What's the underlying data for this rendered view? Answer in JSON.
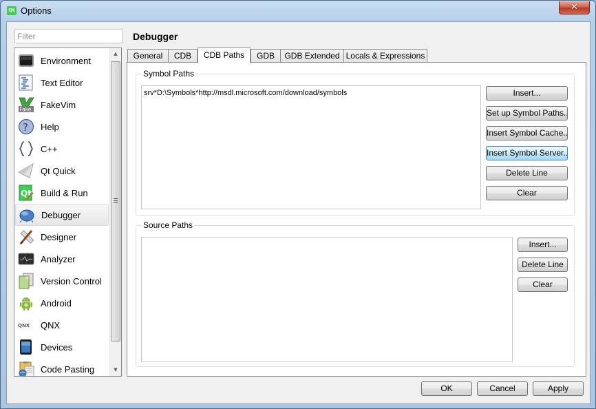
{
  "window": {
    "title": "Options",
    "app_icon": "qt-creator-icon",
    "close_label": "✕"
  },
  "sidebar": {
    "filter_placeholder": "Filter",
    "filter_value": "",
    "items": [
      {
        "label": "Environment",
        "icon": "monitor-icon"
      },
      {
        "label": "Text Editor",
        "icon": "text-document-icon"
      },
      {
        "label": "FakeVim",
        "icon": "fakevim-icon"
      },
      {
        "label": "Help",
        "icon": "help-icon"
      },
      {
        "label": "C++",
        "icon": "braces-icon"
      },
      {
        "label": "Qt Quick",
        "icon": "paper-plane-icon"
      },
      {
        "label": "Build & Run",
        "icon": "qt-build-icon"
      },
      {
        "label": "Debugger",
        "icon": "bug-icon",
        "selected": true
      },
      {
        "label": "Designer",
        "icon": "ruler-brush-icon"
      },
      {
        "label": "Analyzer",
        "icon": "oscilloscope-icon"
      },
      {
        "label": "Version Control",
        "icon": "version-control-icon"
      },
      {
        "label": "Android",
        "icon": "android-icon"
      },
      {
        "label": "QNX",
        "icon": "qnx-icon"
      },
      {
        "label": "Devices",
        "icon": "device-icon"
      },
      {
        "label": "Code Pasting",
        "icon": "code-pasting-icon"
      }
    ],
    "qnx_icon_text": "QNX"
  },
  "main": {
    "page_title": "Debugger",
    "tabs": [
      {
        "label": "General"
      },
      {
        "label": "CDB"
      },
      {
        "label": "CDB Paths",
        "active": true
      },
      {
        "label": "GDB"
      },
      {
        "label": "GDB Extended"
      },
      {
        "label": "Locals & Expressions"
      }
    ],
    "symbol_paths": {
      "title": "Symbol Paths",
      "value": "srv*D:\\Symbols*http://msdl.microsoft.com/download/symbols",
      "buttons": [
        {
          "label": "Insert..."
        },
        {
          "label": "Set up Symbol Paths..."
        },
        {
          "label": "Insert Symbol Cache..."
        },
        {
          "label": "Insert Symbol Server...",
          "focused": true
        },
        {
          "label": "Delete Line"
        },
        {
          "label": "Clear"
        }
      ]
    },
    "source_paths": {
      "title": "Source Paths",
      "value": "",
      "buttons": [
        {
          "label": "Insert..."
        },
        {
          "label": "Delete Line"
        },
        {
          "label": "Clear"
        }
      ]
    }
  },
  "footer": {
    "ok_label": "OK",
    "cancel_label": "Cancel",
    "apply_label": "Apply"
  }
}
